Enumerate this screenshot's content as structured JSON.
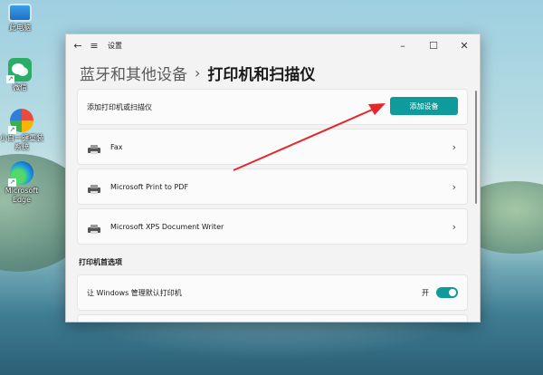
{
  "desktop": {
    "icons": [
      {
        "label": "此电脑"
      },
      {
        "label": "微信"
      },
      {
        "label": "小白一键重装系统"
      },
      {
        "label": "Microsoft Edge"
      }
    ]
  },
  "window": {
    "title": "设置",
    "breadcrumb": {
      "parent": "蓝牙和其他设备",
      "separator": "›",
      "current": "打印机和扫描仪"
    },
    "add_card": {
      "label": "添加打印机或扫描仪",
      "button": "添加设备"
    },
    "printers": [
      {
        "name": "Fax"
      },
      {
        "name": "Microsoft Print to PDF"
      },
      {
        "name": "Microsoft XPS Document Writer"
      }
    ],
    "preferences": {
      "section_title": "打印机首选项",
      "manage_default": {
        "label": "让 Windows 管理默认打印机",
        "state_label": "开",
        "on": true
      }
    }
  },
  "colors": {
    "accent": "#0f9b9b",
    "annotation_arrow": "#e8262a"
  }
}
